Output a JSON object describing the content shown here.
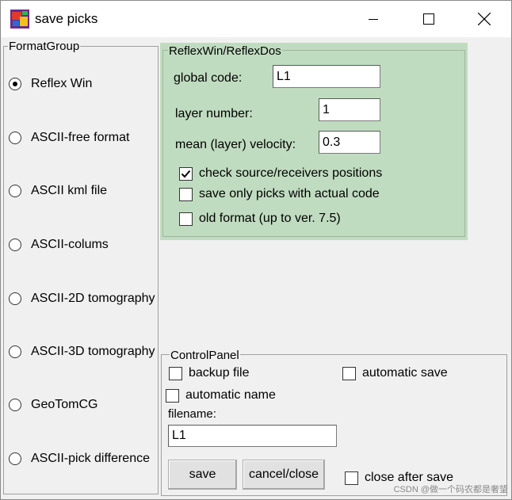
{
  "window": {
    "title": "save picks",
    "controls": {
      "minimize_icon": "minimize-icon",
      "maximize_icon": "maximize-icon",
      "close_icon": "close-icon"
    }
  },
  "format_group": {
    "label": "FormatGroup",
    "options": [
      {
        "label": "Reflex Win",
        "checked": true
      },
      {
        "label": "ASCII-free format",
        "checked": false
      },
      {
        "label": "ASCII kml file",
        "checked": false
      },
      {
        "label": "ASCII-colums",
        "checked": false
      },
      {
        "label": "ASCII-2D tomography",
        "checked": false
      },
      {
        "label": "ASCII-3D tomography",
        "checked": false
      },
      {
        "label": "GeoTomCG",
        "checked": false
      },
      {
        "label": "ASCII-pick difference",
        "checked": false
      }
    ]
  },
  "reflex": {
    "label": "ReflexWin/ReflexDos",
    "global_code_label": "global code:",
    "global_code_value": "L1",
    "layer_number_label": "layer number:",
    "layer_number_value": "1",
    "velocity_label": "mean (layer) velocity:",
    "velocity_value": "0.3",
    "checkboxes": [
      {
        "label": "check source/receivers positions",
        "checked": true
      },
      {
        "label": "save only picks with actual code",
        "checked": false
      },
      {
        "label": "old format (up to ver. 7.5)",
        "checked": false
      }
    ],
    "panel_color": "#c0dcc0"
  },
  "control_panel": {
    "label": "ControlPanel",
    "backup_file_label": "backup file",
    "automatic_save_label": "automatic save",
    "automatic_name_label": "automatic name",
    "filename_label": "filename:",
    "filename_value": "L1",
    "save_label": "save",
    "cancel_label": "cancel/close",
    "close_after_save_label": "close after save"
  },
  "watermark": "CSDN @做一个码农都是奢望"
}
